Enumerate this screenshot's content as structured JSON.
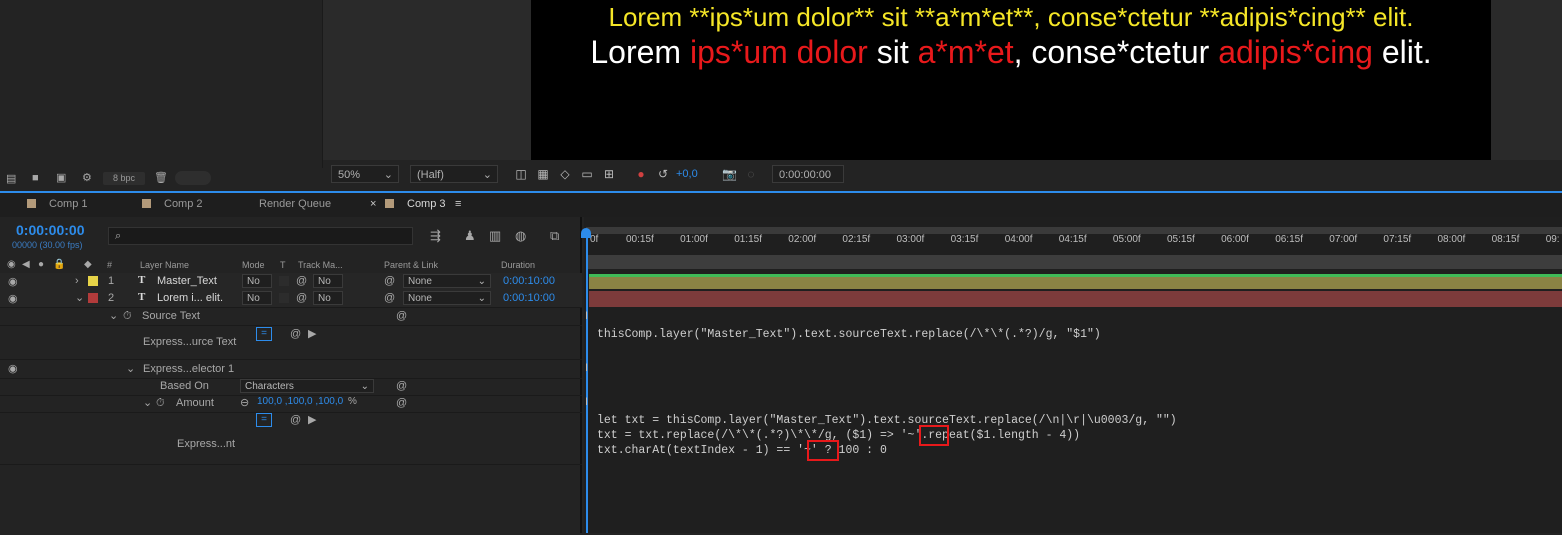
{
  "project_toolbar": {
    "bpc_label": "8 bpc"
  },
  "viewer": {
    "line1": [
      "Lorem **ips*um dolor** sit **a*m*et**, conse*ctetur **adipis*cing** elit."
    ],
    "line2": [
      {
        "t": "Lorem ",
        "c": "white"
      },
      {
        "t": "ips*um dolor",
        "c": "red"
      },
      {
        "t": " sit ",
        "c": "white"
      },
      {
        "t": "a*m*et",
        "c": "red"
      },
      {
        "t": ", conse*ctetur ",
        "c": "white"
      },
      {
        "t": "adipis*cing",
        "c": "red"
      },
      {
        "t": " elit.",
        "c": "white"
      }
    ],
    "zoom": "50%",
    "resolution": "(Half)",
    "exposure": "+0,0",
    "timecode": "0:00:00:00"
  },
  "tabs": [
    {
      "label": "Comp 1",
      "swatch": true
    },
    {
      "label": "Comp 2",
      "swatch": true
    },
    {
      "label": "Render Queue",
      "swatch": false
    },
    {
      "label": "Comp 3",
      "swatch": true,
      "active": true
    }
  ],
  "timeline": {
    "current_time": "0:00:00:00",
    "frame_info": "00000 (30.00 fps)",
    "search_placeholder": "",
    "headers": {
      "num": "#",
      "layer_name": "Layer Name",
      "mode": "Mode",
      "t": "T",
      "track_matte": "Track Ma...",
      "parent": "Parent & Link",
      "duration": "Duration"
    },
    "layers": [
      {
        "num": "1",
        "name": "Master_Text",
        "color": "#e6d348",
        "mode": "No",
        "trkmat": "No",
        "parent": "None",
        "duration": "0:00:10:00"
      },
      {
        "num": "2",
        "name": "Lorem i... elit.",
        "color": "#b23b3b",
        "mode": "No",
        "trkmat": "No",
        "parent": "None",
        "duration": "0:00:10:00"
      }
    ],
    "props": {
      "source_text": "Source Text",
      "expr_source_text": "Express...urce Text",
      "expr_selector": "Express...elector 1",
      "based_on_label": "Based On",
      "based_on_value": "Characters",
      "amount_label": "Amount",
      "amount_value": "100,0 ,100,0 ,100,0",
      "amount_unit": "%",
      "expr_amount": "Express...nt"
    },
    "ruler": [
      "0f",
      "00:15f",
      "01:00f",
      "01:15f",
      "02:00f",
      "02:15f",
      "03:00f",
      "03:15f",
      "04:00f",
      "04:15f",
      "05:00f",
      "05:15f",
      "06:00f",
      "06:15f",
      "07:00f",
      "07:15f",
      "08:00f",
      "08:15f",
      "09:"
    ],
    "expr1": "thisComp.layer(\"Master_Text\").text.sourceText.replace(/\\*\\*(.*?)/g, \"$1\")",
    "expr2_line1": "let txt = thisComp.layer(\"Master_Text\").text.sourceText.replace(/\\n|\\r|\\u0003/g, \"\")",
    "expr2_line2": "txt = txt.replace(/\\*\\*(.*?)\\*\\*/g, ($1) => '~'.repeat($1.length - 4))",
    "expr2_line3": "txt.charAt(textIndex - 1) == '~' ? 100 : 0"
  }
}
